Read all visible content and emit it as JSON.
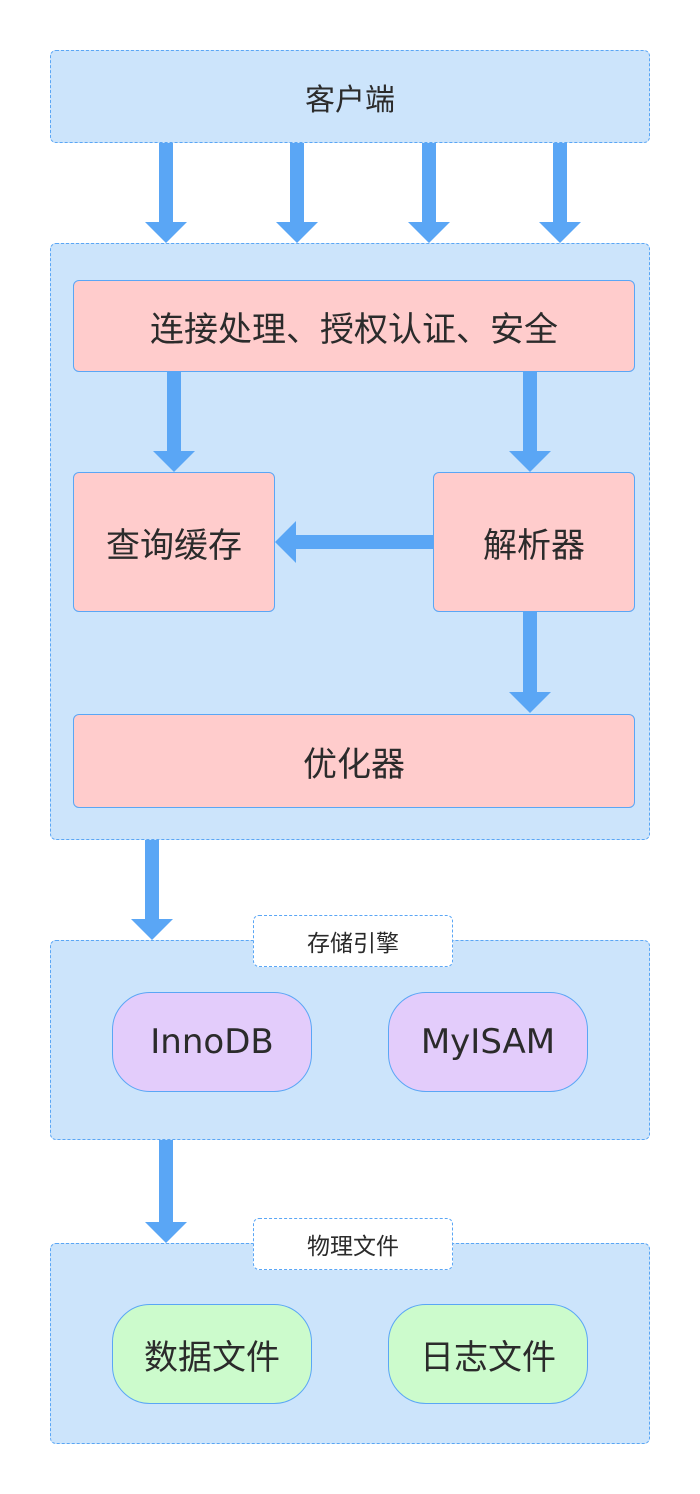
{
  "client": {
    "label": "客户端"
  },
  "server": {
    "connection_label": "连接处理、授权认证、安全",
    "query_cache_label": "查询缓存",
    "parser_label": "解析器",
    "optimizer_label": "优化器"
  },
  "storage_engine": {
    "tag": "存储引擎",
    "engines": [
      "InnoDB",
      "MyISAM"
    ]
  },
  "physical_files": {
    "tag": "物理文件",
    "files": [
      "数据文件",
      "日志文件"
    ]
  },
  "colors": {
    "group_fill": "#cce4fb",
    "border": "#5aa6f5",
    "arrow": "#5aa6f5",
    "process_fill": "#ffcccc",
    "engine_fill": "#e3ccfb",
    "file_fill": "#ccfbcc"
  }
}
